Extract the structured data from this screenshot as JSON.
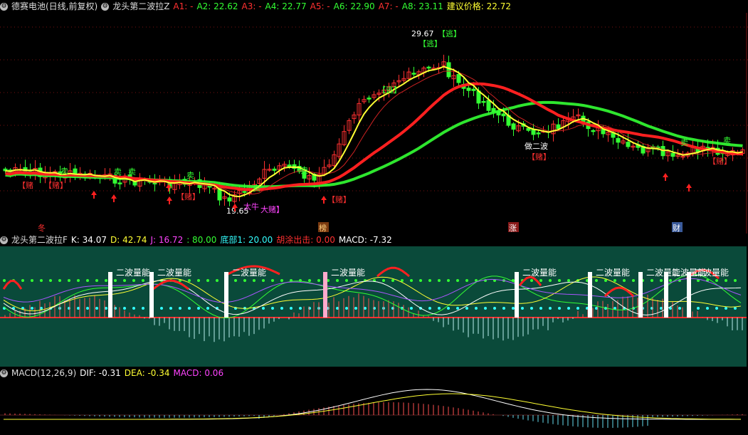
{
  "header1": {
    "stock": "德赛电池(日线,前复权)",
    "indicator": "龙头第二波拉Z",
    "items": [
      {
        "label": "A1: -",
        "color": "#ff3030"
      },
      {
        "label": "A2: 22.62",
        "color": "#33ff33"
      },
      {
        "label": "A3: -",
        "color": "#ff3030"
      },
      {
        "label": "A4: 22.77",
        "color": "#33ff33"
      },
      {
        "label": "A5: -",
        "color": "#ff3030"
      },
      {
        "label": "A6: 22.90",
        "color": "#33ff33"
      },
      {
        "label": "A7: -",
        "color": "#ff3030"
      },
      {
        "label": "A8: 23.11",
        "color": "#33ff33"
      },
      {
        "label": "建议价格: 22.72",
        "color": "#ffff33"
      }
    ]
  },
  "header2": {
    "indicator": "龙头第二波拉F",
    "items": [
      {
        "label": "K: 34.07",
        "color": "#ffffff"
      },
      {
        "label": "D: 42.74",
        "color": "#ffff33"
      },
      {
        "label": "J: 16.72",
        "color": "#ff44ff"
      },
      {
        "label": ": 80.00",
        "color": "#33ff33"
      },
      {
        "label": "底部1: 20.00",
        "color": "#33ffff"
      },
      {
        "label": "胡涂出击: 0.00",
        "color": "#ff3030"
      },
      {
        "label": "MACD: -7.32",
        "color": "#ffffff"
      }
    ]
  },
  "header3": {
    "indicator": "MACD(12,26,9)",
    "items": [
      {
        "label": "DIF: -0.31",
        "color": "#ffffff"
      },
      {
        "label": "DEA: -0.34",
        "color": "#ffff33"
      },
      {
        "label": "MACD: 0.06",
        "color": "#ff44ff"
      }
    ]
  },
  "annotations": {
    "high_price": "29.67",
    "low_price": "19.65",
    "escape": "【逃】",
    "sell": "卖",
    "buy": "【赌】",
    "gamble_prefix": "【赌",
    "gamble_suffix": "】",
    "big_bull": "太牛",
    "big_gamble": "大赌】",
    "zuo_er_bo": "做二波",
    "second_wave": "二波量能"
  },
  "markers": [
    {
      "label": "冬",
      "color": "#ff3030",
      "bg": "none"
    },
    {
      "label": "榜",
      "color": "#ffd27f",
      "bg": "#7a3a10"
    },
    {
      "label": "涨",
      "color": "#ffffff",
      "bg": "#8a1a1a"
    },
    {
      "label": "财",
      "color": "#ffffff",
      "bg": "#3a5a9a"
    }
  ],
  "colors": {
    "up": "#ff3030",
    "down": "#33ff33",
    "ma_fast": "#ffff33",
    "ma_slow": "#ff2020",
    "ma_long": "#33ff33",
    "panel2_bg": "#0a4a3a",
    "dotted_top": "#33ff33",
    "dotted_bottom": "#33ffff"
  }
}
